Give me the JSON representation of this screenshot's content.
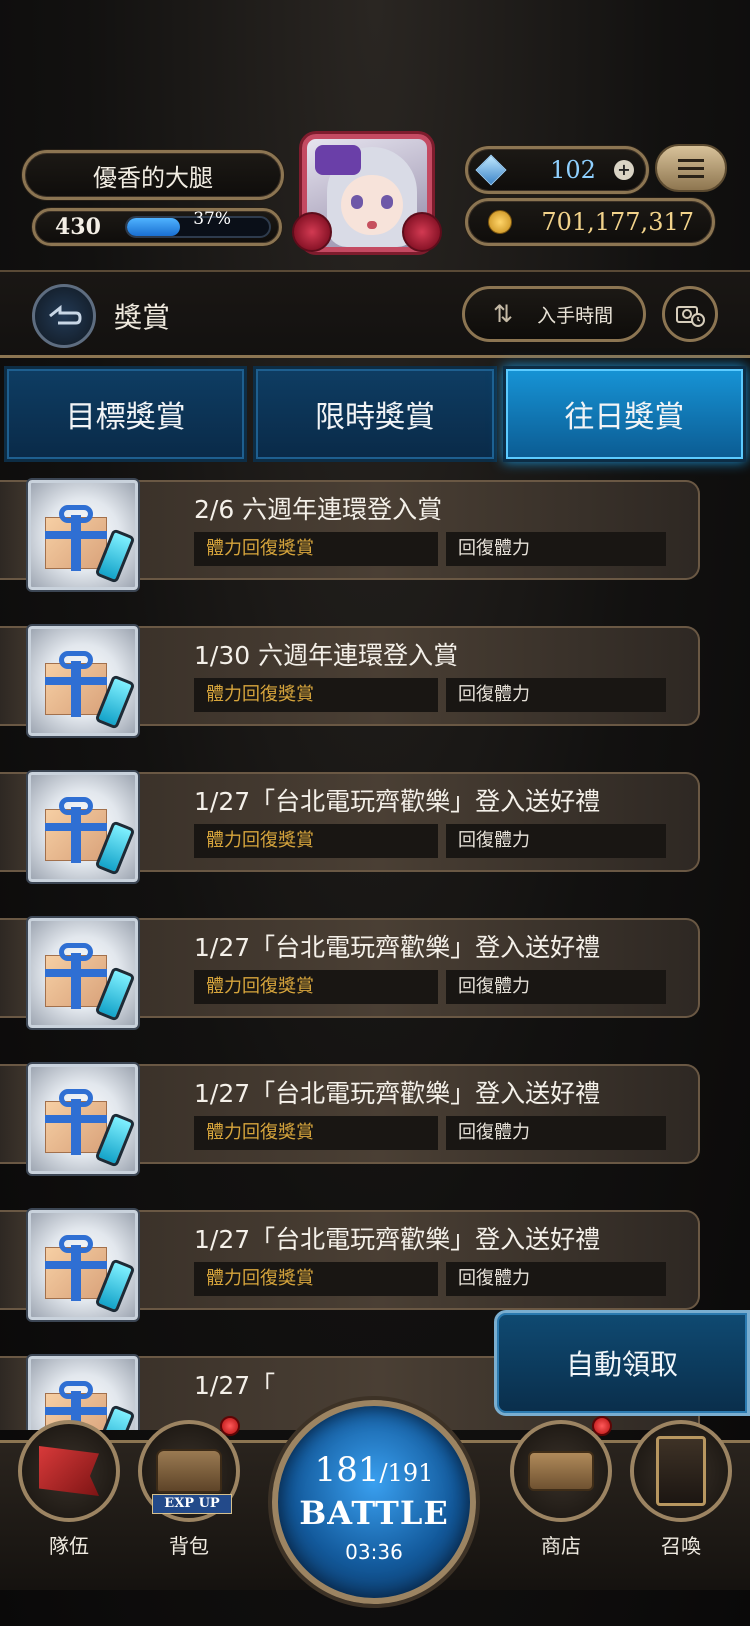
{
  "player": {
    "name": "優香的大腿",
    "level": "430",
    "exp_percent_label": "37%",
    "exp_fraction": 0.37
  },
  "currency": {
    "gems": "102",
    "gold": "701,177,317"
  },
  "header": {
    "title": "獎賞",
    "sort_label": "入手時間"
  },
  "tabs": [
    {
      "label": "目標獎賞",
      "active": false
    },
    {
      "label": "限時獎賞",
      "active": false
    },
    {
      "label": "往日獎賞",
      "active": true
    }
  ],
  "rewards": [
    {
      "title": "2/6 六週年連環登入賞",
      "type": "體力回復獎賞",
      "desc": "回復體力"
    },
    {
      "title": "1/30 六週年連環登入賞",
      "type": "體力回復獎賞",
      "desc": "回復體力"
    },
    {
      "title": "1/27「台北電玩齊歡樂」登入送好禮",
      "type": "體力回復獎賞",
      "desc": "回復體力"
    },
    {
      "title": "1/27「台北電玩齊歡樂」登入送好禮",
      "type": "體力回復獎賞",
      "desc": "回復體力"
    },
    {
      "title": "1/27「台北電玩齊歡樂」登入送好禮",
      "type": "體力回復獎賞",
      "desc": "回復體力"
    },
    {
      "title": "1/27「台北電玩齊歡樂」登入送好禮",
      "type": "體力回復獎賞",
      "desc": "回復體力"
    },
    {
      "title": "1/27「",
      "type": "",
      "desc": ""
    }
  ],
  "auto_claim_label": "自動領取",
  "nav": {
    "team": "隊伍",
    "bag": "背包",
    "exp_up": "EXP UP",
    "shop": "商店",
    "summon": "召喚"
  },
  "battle": {
    "stamina": "181",
    "stamina_max": "/191",
    "label": "BATTLE",
    "timer": "03:36"
  },
  "colors": {
    "active_tab": "#1794d6",
    "tag_type_text": "#d7a53c",
    "gold_frame": "#8c7552"
  }
}
